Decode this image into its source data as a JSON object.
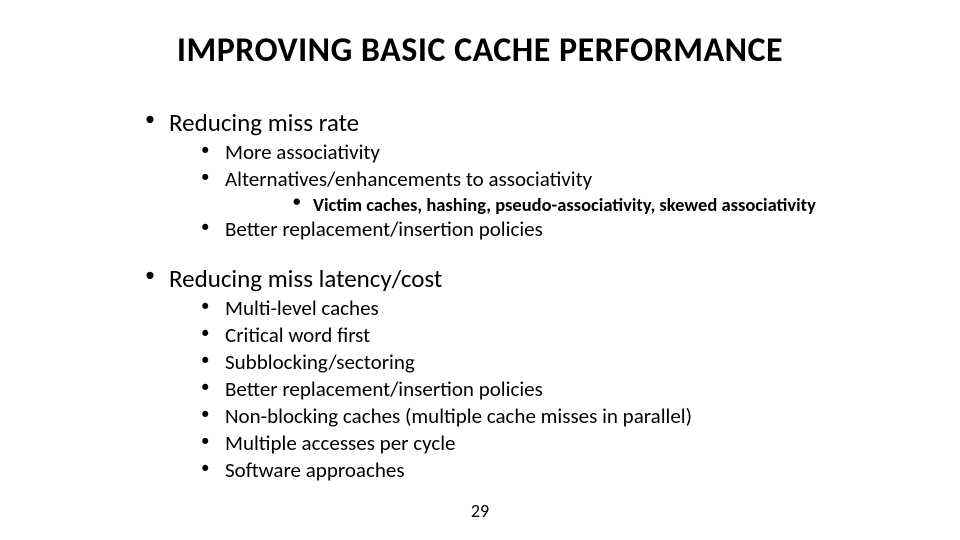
{
  "title": "IMPROVING BASIC CACHE PERFORMANCE",
  "sections": [
    {
      "heading": "Reducing miss rate",
      "items": [
        {
          "text": "More associativity"
        },
        {
          "text": "Alternatives/enhancements to associativity",
          "sub": [
            "Victim caches, hashing, pseudo-associativity, skewed associativity"
          ]
        },
        {
          "text": "Better replacement/insertion policies"
        }
      ]
    },
    {
      "heading": "Reducing miss latency/cost",
      "items": [
        {
          "text": "Multi-level caches"
        },
        {
          "text": "Critical word first"
        },
        {
          "text": "Subblocking/sectoring"
        },
        {
          "text": "Better replacement/insertion policies"
        },
        {
          "text": "Non-blocking caches (multiple cache misses in parallel)"
        },
        {
          "text": "Multiple accesses per cycle"
        },
        {
          "text": "Software approaches"
        }
      ]
    }
  ],
  "page_number": "29"
}
